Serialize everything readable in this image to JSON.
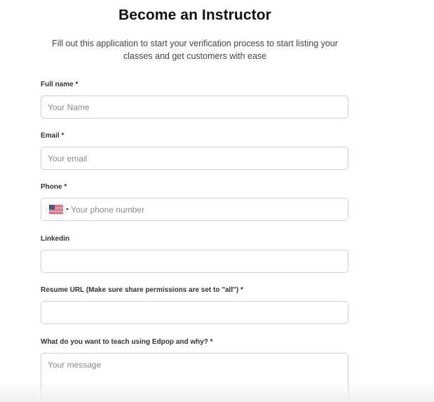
{
  "header": {
    "title": "Become an Instructor",
    "subtitle": "Fill out this application to start your verification process to start listing your classes and get customers with ease"
  },
  "form": {
    "full_name": {
      "label": "Full name *",
      "placeholder": "Your Name",
      "value": ""
    },
    "email": {
      "label": "Email *",
      "placeholder": "Your email",
      "value": ""
    },
    "phone": {
      "label": "Phone *",
      "country_flag": "us-flag-icon",
      "placeholder": "Your phone number",
      "value": ""
    },
    "linkedin": {
      "label": "Linkedin",
      "placeholder": "",
      "value": ""
    },
    "resume_url": {
      "label": "Resume URL (Make sure share permissions are set to \"all\") *",
      "placeholder": "",
      "value": ""
    },
    "teach_reason": {
      "label": "What do you want to teach using Edpop and why? *",
      "placeholder": "Your message",
      "value": ""
    }
  },
  "colors": {
    "border": "#cfcfd4",
    "placeholder": "#8a8a8f",
    "title": "#111111"
  }
}
